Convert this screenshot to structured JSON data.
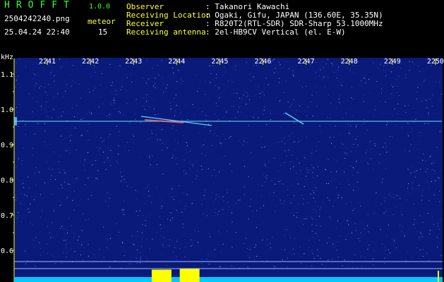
{
  "header": {
    "brand": "HROFFT",
    "version": "1.0.0",
    "filename": "2504242240.png",
    "datetime": "25.04.24 22:40",
    "meteor_label": "meteor",
    "meteor_count": "15",
    "info": [
      {
        "label": "Observer",
        "value": ": Takanori Kawachi"
      },
      {
        "label": "Receiving Location",
        "value": ": Ogaki, Gifu, JAPAN (136.60E, 35.35N)"
      },
      {
        "label": "Receiver",
        "value": ": R820T2(RTL-SDR) SDR-Sharp 53.1000MHz"
      },
      {
        "label": "Receiving antenna",
        "value": ": 2el-HB9CV Vertical (el. E-W)"
      }
    ]
  },
  "spectrogram": {
    "y_unit": "kHz",
    "x_ticks": [
      "2241",
      "2242",
      "2243",
      "2244",
      "2245",
      "2246",
      "2247",
      "2248",
      "2249",
      "2250"
    ],
    "y_ticks": [
      "1.1",
      "1.0",
      "0.9",
      "0.8",
      "0.7",
      "0.6"
    ],
    "colors": {
      "background": "#0a1a7a",
      "carrier": "#5fd7ff",
      "meteor": "#ff6a6a",
      "scale": "#ffff00",
      "baseline": "#00c8ff"
    },
    "burst_activity": [
      {
        "x": 2243.65,
        "level": 0.8
      },
      {
        "x": 2244.3,
        "level": 0.85
      }
    ]
  }
}
